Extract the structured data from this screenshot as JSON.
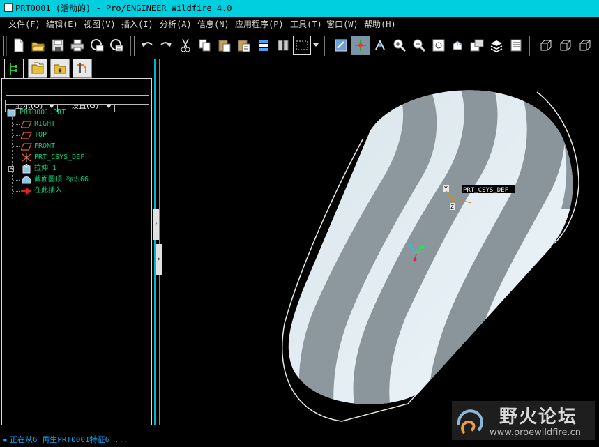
{
  "window": {
    "title": "PRT0001 (活动的) - Pro/ENGINEER Wildfire 4.0"
  },
  "menu": [
    {
      "label": "文件(F)"
    },
    {
      "label": "编辑(E)"
    },
    {
      "label": "视图(V)"
    },
    {
      "label": "插入(I)"
    },
    {
      "label": "分析(A)"
    },
    {
      "label": "信息(N)"
    },
    {
      "label": "应用程序(P)"
    },
    {
      "label": "工具(T)"
    },
    {
      "label": "窗口(W)"
    },
    {
      "label": "帮助(H)"
    }
  ],
  "toolbar": {
    "icons": [
      "new-file-icon",
      "open-file-icon",
      "save-icon",
      "print-icon",
      "email-icon",
      "email-attach-icon",
      "undo-icon",
      "redo-icon",
      "cut-icon",
      "copy-icon",
      "paste-icon",
      "paste-special-icon",
      "regenerate-icon",
      "manager-icon",
      "select-box-icon",
      "repaint-icon",
      "spin-center-icon",
      "orient-icon",
      "zoom-in-icon",
      "zoom-out-icon",
      "refit-icon",
      "reorient-icon",
      "saved-views-icon",
      "layers-icon",
      "view-manager-icon",
      "wireframe-icon",
      "hidden-line-icon",
      "no-hidden-icon"
    ]
  },
  "panel": {
    "tabs": [
      "model-tree-tab",
      "folder-browser-tab",
      "favorites-tab",
      "connections-tab"
    ],
    "display_dropdown": "显示(O)",
    "settings_dropdown": "设置(G)",
    "tree": {
      "root": "PRT0001.PRT",
      "items": [
        {
          "label": "RIGHT",
          "icon": "datum-plane-icon"
        },
        {
          "label": "TOP",
          "icon": "datum-plane-icon"
        },
        {
          "label": "FRONT",
          "icon": "datum-plane-icon"
        },
        {
          "label": "PRT_CSYS_DEF",
          "icon": "csys-icon"
        },
        {
          "label": "拉伸 1",
          "icon": "extrude-icon"
        },
        {
          "label": "截面圆顶 标识66",
          "icon": "section-dome-icon"
        },
        {
          "label": "在此插入",
          "icon": "insert-here-arrow-icon"
        }
      ]
    }
  },
  "viewport": {
    "csys_label": "PRT_CSYS_DEF",
    "axis_x": "X",
    "axis_y": "Y",
    "axis_z": "Z"
  },
  "status": {
    "message": "正在从6 再生PRT0001特征6 ..."
  },
  "watermark": {
    "title": "野火论坛",
    "url": "www.proewildfire.cn"
  }
}
